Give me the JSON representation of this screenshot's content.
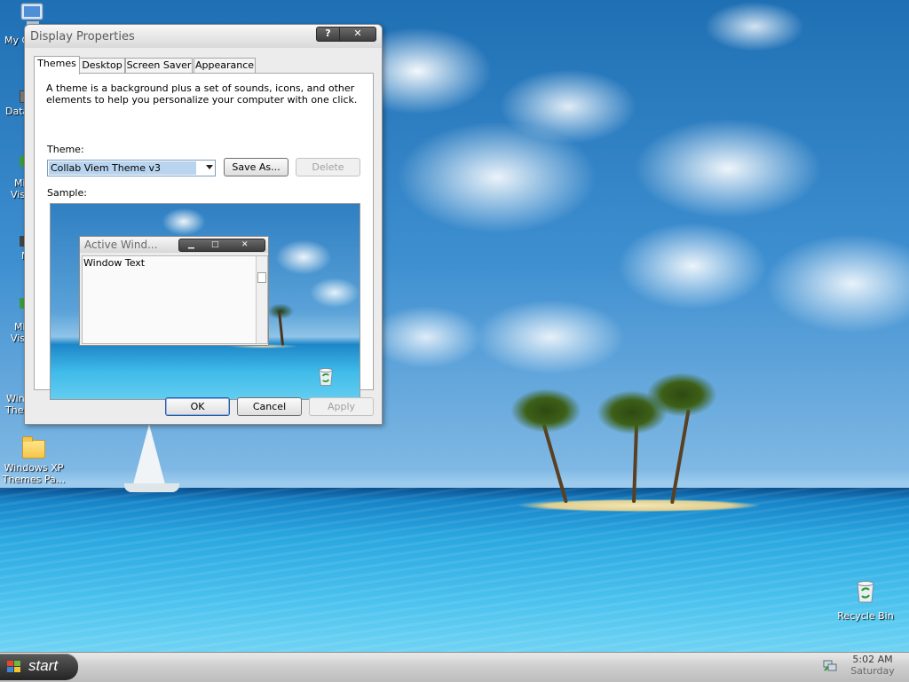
{
  "desktop": {
    "icons": [
      {
        "label": "My C"
      },
      {
        "label": "Data"
      },
      {
        "label_line1": "Mi",
        "label_line2": "Vis"
      },
      {
        "label": "N"
      },
      {
        "label_line1": "Mi",
        "label_line2": "Vis"
      },
      {
        "label_line1": "Wind",
        "label_line2": "Them"
      },
      {
        "label_line1": "Windows XP",
        "label_line2": "Themes Pa..."
      },
      {
        "label": "Recycle Bin"
      }
    ]
  },
  "dialog": {
    "title": "Display Properties",
    "help_label": "?",
    "close_label": "✕",
    "tabs": [
      {
        "label": "Themes"
      },
      {
        "label": "Desktop"
      },
      {
        "label": "Screen Saver"
      },
      {
        "label": "Appearance"
      }
    ],
    "description": "A theme is a background plus a set of sounds, icons, and other elements to help you personalize your computer with one click.",
    "theme_label": "Theme:",
    "theme_value": "Collab Viem Theme v3",
    "save_as_label": "Save As...",
    "delete_label": "Delete",
    "sample_label": "Sample:",
    "sample": {
      "window_title": "Active Wind...",
      "window_text": "Window Text"
    },
    "ok_label": "OK",
    "cancel_label": "Cancel",
    "apply_label": "Apply"
  },
  "taskbar": {
    "start_label": "start",
    "clock_time": "5:02 AM",
    "clock_day": "Saturday"
  }
}
